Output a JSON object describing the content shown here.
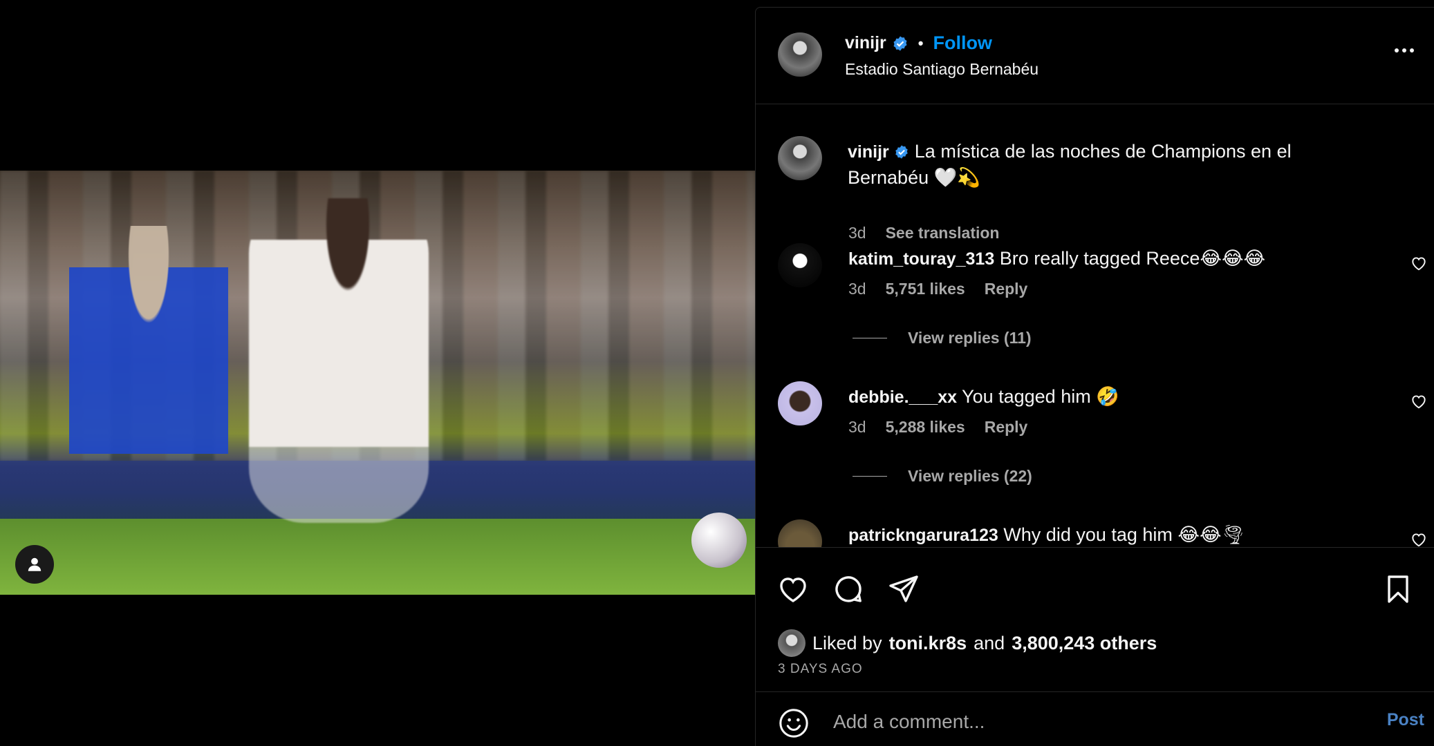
{
  "post": {
    "username": "vinijr",
    "location": "Estadio Santiago Bernabéu",
    "follow_label": "Follow",
    "separator": "•"
  },
  "caption": {
    "username": "vinijr",
    "text": "La mística de las noches de Champions en el Bernabéu 🤍💫",
    "time": "3d",
    "translate_label": "See translation"
  },
  "comments": [
    {
      "username": "katim_touray_313",
      "text": "Bro really tagged Reece😂😂😂",
      "time": "3d",
      "likes": "5,751 likes",
      "reply_label": "Reply",
      "view_replies": "View replies (11)"
    },
    {
      "username": "debbie.___xx",
      "text": "You tagged him 🤣",
      "time": "3d",
      "likes": "5,288 likes",
      "reply_label": "Reply",
      "view_replies": "View replies (22)"
    },
    {
      "username": "patrickngarura123",
      "text": "Why did you tag him 😂😂🌪"
    }
  ],
  "engagement": {
    "liked_by_prefix": "Liked by",
    "liked_by_user": "toni.kr8s",
    "and_label": "and",
    "others": "3,800,243 others",
    "date": "3 DAYS AGO"
  },
  "comment_box": {
    "placeholder": "Add a comment...",
    "post_label": "Post"
  },
  "colors": {
    "accent": "#0095f6",
    "muted": "#a8a8a8",
    "border": "#262626"
  },
  "icons": [
    "person-tag-icon",
    "verified-badge-icon",
    "more-icon",
    "heart-icon",
    "comment-icon",
    "share-icon",
    "bookmark-icon",
    "emoji-icon"
  ]
}
